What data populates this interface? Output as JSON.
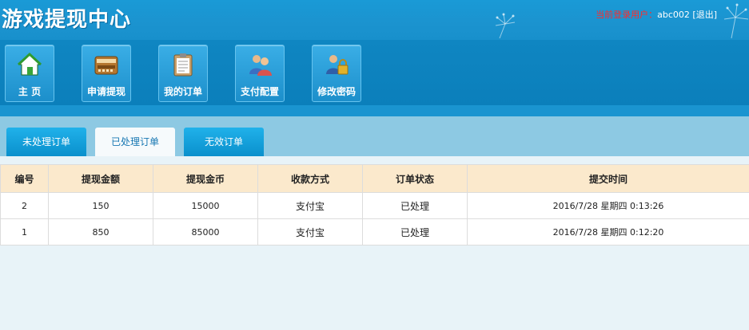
{
  "header": {
    "title": "游戏提现中心",
    "current_user_label": "当前登录用户：",
    "username": "abc002",
    "logout": "[退出]"
  },
  "nav": {
    "items": [
      {
        "label": "主  页",
        "icon": "home-icon"
      },
      {
        "label": "申请提现",
        "icon": "withdraw-icon"
      },
      {
        "label": "我的订单",
        "icon": "orders-icon"
      },
      {
        "label": "支付配置",
        "icon": "payment-config-icon"
      },
      {
        "label": "修改密码",
        "icon": "change-password-icon"
      }
    ]
  },
  "tabs": [
    {
      "label": "未处理订单",
      "active": false
    },
    {
      "label": "已处理订单",
      "active": true
    },
    {
      "label": "无效订单",
      "active": false
    }
  ],
  "table": {
    "headers": [
      "编号",
      "提现金额",
      "提现金币",
      "收款方式",
      "订单状态",
      "提交时间"
    ],
    "rows": [
      [
        "2",
        "150",
        "15000",
        "支付宝",
        "已处理",
        "2016/7/28 星期四 0:13:26"
      ],
      [
        "1",
        "850",
        "85000",
        "支付宝",
        "已处理",
        "2016/7/28 星期四 0:12:20"
      ]
    ]
  },
  "colors": {
    "header_bg": "#1a9ad6",
    "nav_bg": "#0f86c2",
    "tab_area_bg": "#8dc9e3",
    "table_header_bg": "#fbe9cc",
    "user_label_color": "#ff2a2a",
    "page_bg": "#e8f3f8"
  }
}
